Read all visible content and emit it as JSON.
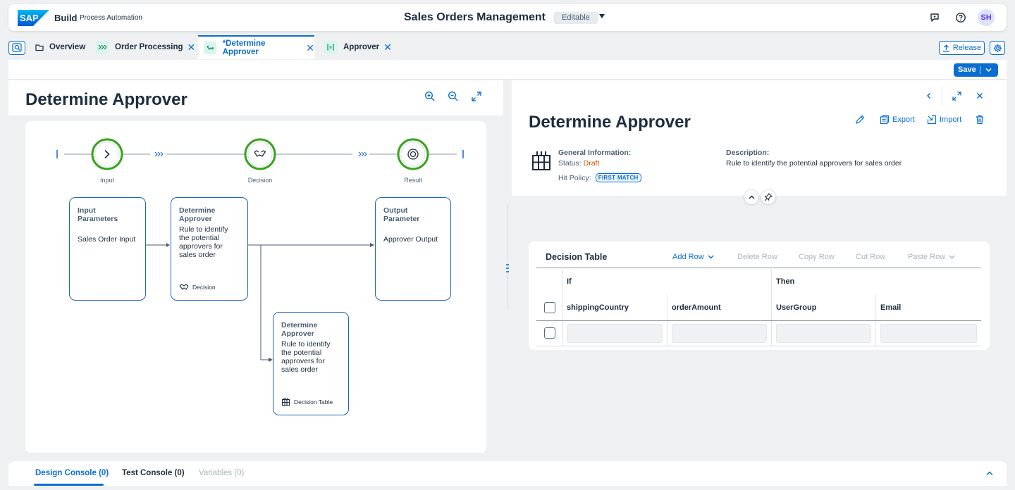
{
  "shell": {
    "logo_text": "SAP",
    "brand": "Build",
    "product": "Process Automation",
    "title": "Sales Orders Management",
    "mode": "Editable",
    "avatar_initials": "SH"
  },
  "tabs": [
    {
      "label": "Overview",
      "icon": "folder-icon",
      "active": false,
      "closable": false
    },
    {
      "label": "Order Processing",
      "icon": "process-icon",
      "active": false,
      "closable": true
    },
    {
      "label": "*Determine Approver",
      "icon": "decision-icon",
      "active": true,
      "closable": true
    },
    {
      "label": "Approver",
      "icon": "form-icon",
      "active": false,
      "closable": true
    }
  ],
  "toolbar": {
    "release_label": "Release",
    "save_label": "Save"
  },
  "canvas": {
    "title": "Determine Approver",
    "stages": {
      "input": "Input",
      "decision": "Decision",
      "result": "Result"
    },
    "boxes": {
      "input": {
        "title": "Input Parameters",
        "body": "Sales Order Input"
      },
      "decision": {
        "title": "Determine Approver",
        "body": "Rule to identify the potential approvers for sales order",
        "foot": "Decision"
      },
      "output": {
        "title": "Output Parameter",
        "body": "Approver Output"
      },
      "table": {
        "title": "Determine Approver",
        "body": "Rule to identify the potential approvers for sales order",
        "foot": "Decision Table"
      }
    }
  },
  "details": {
    "title": "Determine Approver",
    "export_label": "Export",
    "import_label": "Import",
    "general_label": "General Information:",
    "status_label": "Status:",
    "status_value": "Draft",
    "hit_policy_label": "Hit Policy:",
    "hit_policy_value": "FIRST MATCH",
    "description_label": "Description:",
    "description_text": "Rule to identify the potential approvers for sales order"
  },
  "decision_table": {
    "title": "Decision Table",
    "actions": {
      "add_row": "Add Row",
      "delete_row": "Delete Row",
      "copy_row": "Copy Row",
      "cut_row": "Cut Row",
      "paste_row": "Paste Row"
    },
    "if_label": "If",
    "then_label": "Then",
    "columns": [
      "shippingCountry",
      "orderAmount",
      "UserGroup",
      "Email"
    ]
  },
  "console": {
    "tabs": [
      "Design Console (0)",
      "Test Console (0)",
      "Variables (0)"
    ]
  },
  "colors": {
    "accent": "#0a6ed1",
    "node_ring": "#36a41d",
    "status_draft": "#c35500",
    "box_border": "#1b65c4"
  }
}
